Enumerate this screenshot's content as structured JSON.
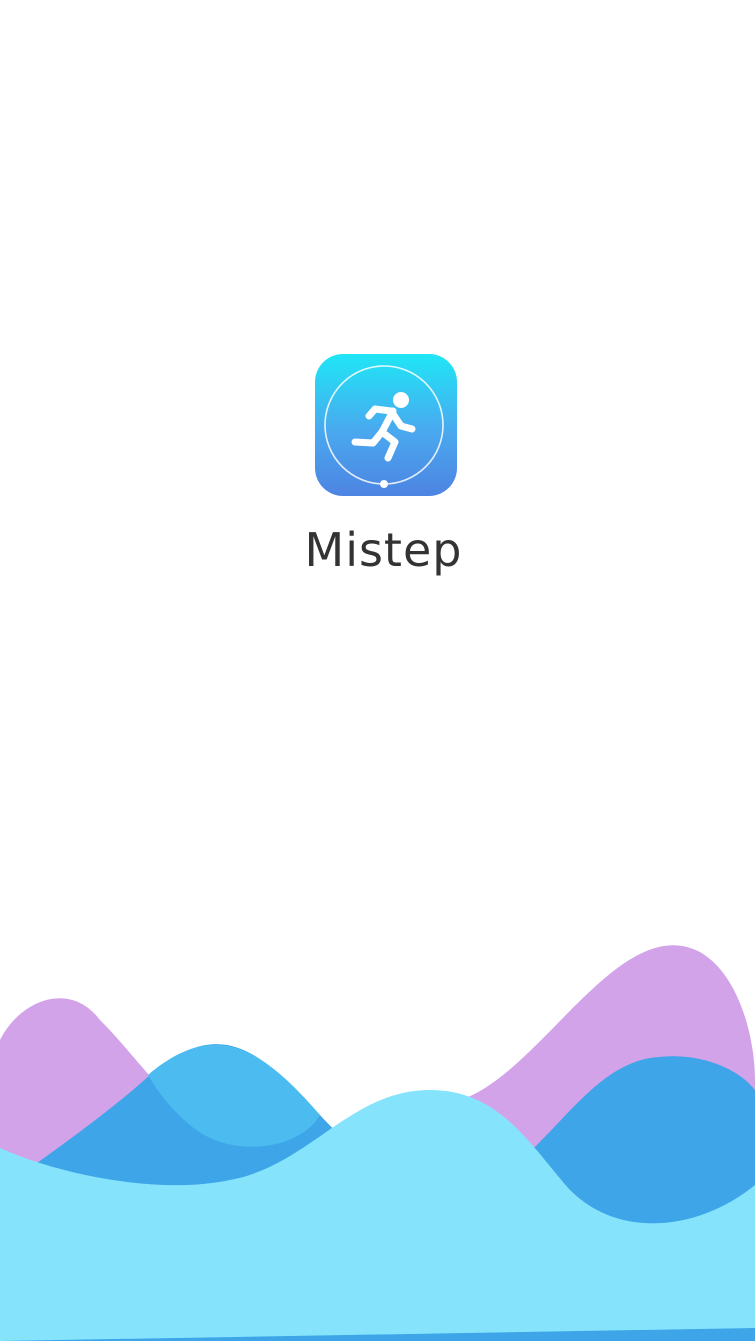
{
  "splash": {
    "app_name": "Mistep",
    "icon": "running-person-icon",
    "icon_gradient": [
      "#1fe6f6",
      "#4aa8ef",
      "#4d84e2"
    ],
    "wave_colors": {
      "back_purple": "#d3a3ea",
      "middle_blue": "#3da5e8",
      "front_light_blue": "#85e4fc",
      "overlap_blue": "#4cbcf0"
    }
  }
}
